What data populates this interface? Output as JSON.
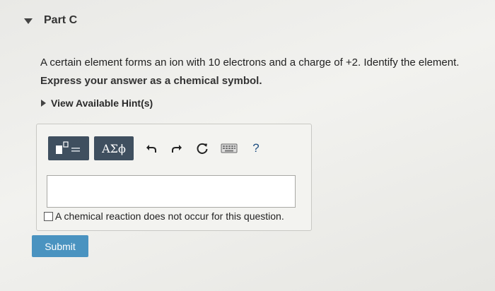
{
  "part": {
    "title": "Part C"
  },
  "question": {
    "text": "A certain element forms an ion with 10 electrons and a charge of +2. Identify the element.",
    "instruction": "Express your answer as a chemical symbol."
  },
  "hints": {
    "label": "View Available Hint(s)"
  },
  "toolbar": {
    "templates_icon": "templates-icon",
    "symbols_label": "ΑΣϕ",
    "undo_icon": "undo-icon",
    "redo_icon": "redo-icon",
    "reset_icon": "reset-icon",
    "keyboard_icon": "keyboard-icon",
    "help_label": "?"
  },
  "answer": {
    "value": ""
  },
  "checkbox": {
    "label": "A chemical reaction does not occur for this question.",
    "checked": false
  },
  "submit": {
    "label": "Submit"
  },
  "colors": {
    "toolbar_button": "#3f4f5f",
    "submit_button": "#4a93c0",
    "help": "#1f4f82"
  }
}
